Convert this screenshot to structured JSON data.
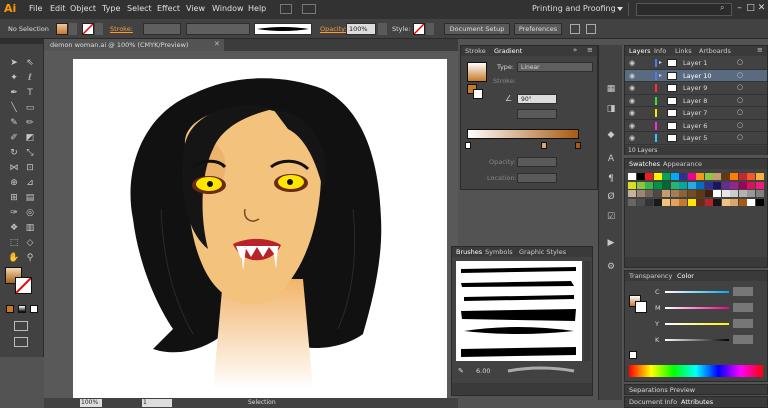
{
  "app": {
    "logo": "Ai"
  },
  "menu": [
    "File",
    "Edit",
    "Object",
    "Type",
    "Select",
    "Effect",
    "View",
    "Window",
    "Help"
  ],
  "workspace": "Printing and Proofing",
  "control": {
    "selection": "No Selection",
    "stroke_label": "Stroke:",
    "opacity_label": "Opacity:",
    "opacity_value": "100%",
    "style_label": "Style:",
    "doc_setup": "Document Setup",
    "preferences": "Preferences"
  },
  "document": {
    "tab": "demon woman.ai @ 100% (CMYK/Preview)",
    "zoom": "100%",
    "page": "1",
    "status": "Selection"
  },
  "gradient": {
    "tabs": [
      "Stroke",
      "Gradient"
    ],
    "type_label": "Type:",
    "type_value": "Linear",
    "stroke_label": "Stroke:",
    "angle": "90°",
    "opacity_label": "Opacity:",
    "location_label": "Location:"
  },
  "brushes": {
    "tabs": [
      "Brushes",
      "Symbols",
      "Graphic Styles"
    ],
    "size": "6.00"
  },
  "layers": {
    "tabs": [
      "Layers",
      "Info",
      "Links",
      "Artboards"
    ],
    "items": [
      "Layer 1",
      "Layer 10",
      "Layer 9",
      "Layer 8",
      "Layer 7",
      "Layer 6",
      "Layer 5"
    ],
    "count": "10 Layers",
    "colors": [
      "#4a7bff",
      "#4a7bff",
      "#ff3030",
      "#3adf3a",
      "#ffe600",
      "#ff2ad6",
      "#2ac8ff"
    ]
  },
  "swatches": {
    "tabs": [
      "Swatches",
      "Appearance"
    ]
  },
  "color": {
    "tabs": [
      "Transparency",
      "Color"
    ],
    "channels": [
      "C",
      "M",
      "Y",
      "K"
    ]
  },
  "bottom_panels": {
    "sep": "Separations Preview",
    "doc_info": "Document Info",
    "attributes": "Attributes"
  }
}
